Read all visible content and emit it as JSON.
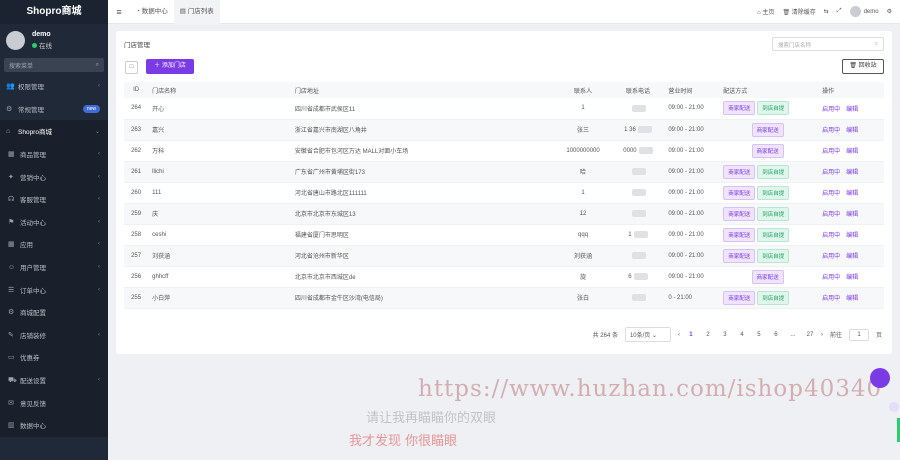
{
  "app": {
    "name": "Shopro商城"
  },
  "user": {
    "name": "demo",
    "status": "在线"
  },
  "sidebar": {
    "search_placeholder": "搜索菜单",
    "items": [
      {
        "label": "权限管理",
        "icon": "users-icon",
        "arrow": true
      },
      {
        "label": "常规管理",
        "icon": "gear-icon",
        "badge": "new"
      },
      {
        "label": "Shopro商城",
        "icon": "home-icon",
        "arrow": true,
        "active": true
      },
      {
        "label": "商品管理",
        "icon": "box-icon",
        "arrow": true,
        "sub": true
      },
      {
        "label": "营销中心",
        "icon": "megaphone-icon",
        "arrow": true,
        "sub": true
      },
      {
        "label": "客服管理",
        "icon": "headset-icon",
        "arrow": true,
        "sub": true
      },
      {
        "label": "活动中心",
        "icon": "flag-icon",
        "arrow": true,
        "sub": true
      },
      {
        "label": "应用",
        "icon": "grid-icon",
        "arrow": true,
        "sub": true
      },
      {
        "label": "用户管理",
        "icon": "user-icon",
        "arrow": true,
        "sub": true
      },
      {
        "label": "订单中心",
        "icon": "list-icon",
        "arrow": true,
        "sub": true
      },
      {
        "label": "商城配置",
        "icon": "settings-icon",
        "sub": true
      },
      {
        "label": "店铺装修",
        "icon": "brush-icon",
        "arrow": true,
        "sub": true
      },
      {
        "label": "优惠券",
        "icon": "ticket-icon",
        "sub": true
      },
      {
        "label": "配送设置",
        "icon": "truck-icon",
        "arrow": true,
        "sub": true
      },
      {
        "label": "意见反馈",
        "icon": "chat-icon",
        "sub": true
      },
      {
        "label": "数据中心",
        "icon": "chart-icon",
        "sub": true
      }
    ]
  },
  "topbar": {
    "tabs": [
      {
        "label": "数据中心",
        "icon": "dashboard-icon"
      },
      {
        "label": "门店列表",
        "icon": "file-icon",
        "active": true
      }
    ],
    "home": "主页",
    "clear_cache": "清除缓存",
    "user": "demo"
  },
  "panel": {
    "title": "门店管理",
    "search_placeholder": "搜索门店名称",
    "add_button": "添加门店",
    "recycle_button": "回收站"
  },
  "table": {
    "headers": [
      "ID",
      "门店名称",
      "门店地址",
      "联系人",
      "联系电话",
      "营业时间",
      "配送方式",
      "操作"
    ],
    "rows": [
      {
        "id": "264",
        "name": "开心",
        "address": "四川省成都市武侯区11",
        "contact": "1",
        "phone": "",
        "hours": "09:00 - 21:00",
        "delivery": [
          "商家配送",
          "到店自提"
        ],
        "ops": [
          "启用中",
          "编辑"
        ]
      },
      {
        "id": "263",
        "name": "嘉兴",
        "address": "浙江省嘉兴市南湖区八角井",
        "contact": "张三",
        "phone": "1         36",
        "hours": "09:00 - 21:00",
        "delivery": [
          "商家配送"
        ],
        "ops": [
          "启用中",
          "编辑"
        ]
      },
      {
        "id": "262",
        "name": "万科",
        "address": "安徽省合肥市包河区万达 MALL对面小车场",
        "contact": "1000000000",
        "phone": "0000",
        "hours": "09:00 - 21:00",
        "delivery": [
          "商家配送"
        ],
        "ops": [
          "启用中",
          "编辑"
        ]
      },
      {
        "id": "261",
        "name": "llichi",
        "address": "广东省广州市黄埔区街173",
        "contact": "哈",
        "phone": "",
        "hours": "09:00 - 21:00",
        "delivery": [
          "商家配送",
          "到店自提"
        ],
        "ops": [
          "启用中",
          "编辑"
        ]
      },
      {
        "id": "260",
        "name": "111",
        "address": "河北省唐山市路北区111111",
        "contact": "1",
        "phone": "",
        "hours": "09:00 - 21:00",
        "delivery": [
          "商家配送",
          "到店自提"
        ],
        "ops": [
          "启用中",
          "编辑"
        ]
      },
      {
        "id": "259",
        "name": "庆",
        "address": "北京市北京市东城区13",
        "contact": "12",
        "phone": "",
        "hours": "09:00 - 21:00",
        "delivery": [
          "商家配送",
          "到店自提"
        ],
        "ops": [
          "启用中",
          "编辑"
        ]
      },
      {
        "id": "258",
        "name": "ceshi",
        "address": "福建省厦门市思明区",
        "contact": "qqq",
        "phone": "1",
        "hours": "09:00 - 21:00",
        "delivery": [
          "商家配送",
          "到店自提"
        ],
        "ops": [
          "启用中",
          "编辑"
        ]
      },
      {
        "id": "257",
        "name": "刘获涵",
        "address": "河北省沧州市新华区",
        "contact": "刘获涵",
        "phone": "",
        "hours": "09:00 - 21:00",
        "delivery": [
          "商家配送",
          "到店自提"
        ],
        "ops": [
          "启用中",
          "编辑"
        ]
      },
      {
        "id": "256",
        "name": "ghhcff",
        "address": "北京市北京市西城区de",
        "contact": "旋",
        "phone": "6",
        "hours": "09:00 - 21:00",
        "delivery": [
          "商家配送"
        ],
        "ops": [
          "启用中",
          "编辑"
        ]
      },
      {
        "id": "255",
        "name": "小白萍",
        "address": "四川省成都市金牛区沙湾(电信局)",
        "contact": "张白",
        "phone": "",
        "hours": "0 - 21:00",
        "delivery": [
          "商家配送",
          "到店自提"
        ],
        "ops": [
          "启用中",
          "编辑"
        ]
      }
    ]
  },
  "pager": {
    "total": "共 264 条",
    "per_page": "10条/页",
    "pages": [
      "1",
      "2",
      "3",
      "4",
      "5",
      "6",
      "...",
      "27"
    ],
    "current": "1",
    "goto_label": "前往",
    "goto_value": "1",
    "goto_suffix": "页"
  },
  "watermark": {
    "url": "https://www.huzhan.com/ishop40340",
    "line1": "请让我再瞄瞄你的双眼",
    "line2": "我才发现 你很瞄眼"
  },
  "colors": {
    "accent": "#7a3be6",
    "sidebar": "#1f2937",
    "green": "#1aa260"
  }
}
